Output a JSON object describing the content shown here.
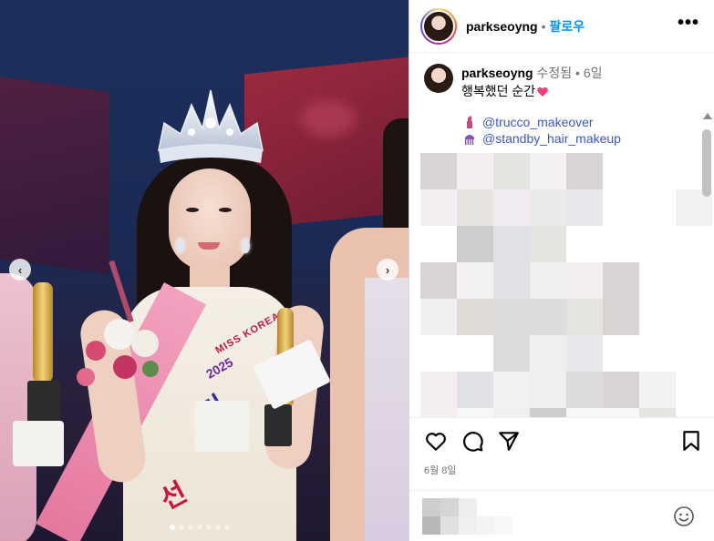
{
  "post": {
    "username": "parkseoyng",
    "follow_label": "팔로우",
    "header_separator": "•",
    "more_label": "•••"
  },
  "photo": {
    "prev_label": "‹",
    "next_label": "›",
    "sash_text": "MISS KOREA",
    "sash_year": "2025",
    "sash_char": "미",
    "sash_bottom": "선",
    "slide_count": 7,
    "active_slide": 1
  },
  "caption": {
    "username": "parkseoyng",
    "edited": "수정됨",
    "separator": "•",
    "age": "6일",
    "text": "행복했던 순간",
    "mentions": [
      {
        "icon": "lipstick-icon",
        "handle": "@trucco_makeover"
      },
      {
        "icon": "comb-icon",
        "handle": "@standby_hair_makeup"
      }
    ]
  },
  "date": "6월 8일",
  "colors": {
    "follow": "#0095f6",
    "mention": "#3d57c7",
    "heart": "#f0407a"
  },
  "icons": [
    "heart-icon",
    "comment-icon",
    "share-icon",
    "bookmark-icon",
    "emoji-icon"
  ]
}
